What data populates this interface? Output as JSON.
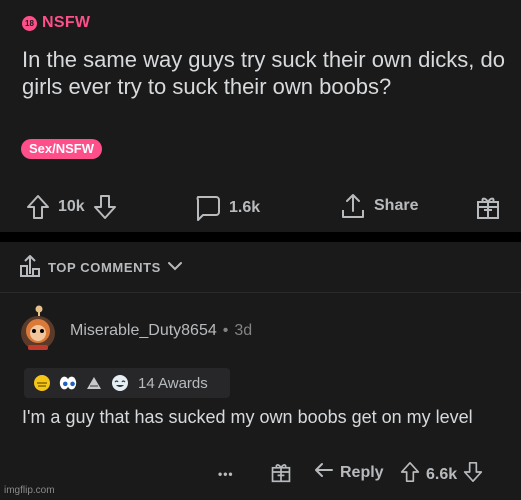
{
  "post": {
    "nsfw_icon_text": "18",
    "nsfw_label": "NSFW",
    "title": "In the same way guys try suck their own dicks, do girls ever try to suck their own boobs?",
    "flair": "Sex/NSFW",
    "upvotes": "10k",
    "comments": "1.6k",
    "share_label": "Share"
  },
  "comments_header": {
    "sort_label": "TOP COMMENTS"
  },
  "comment": {
    "author": "Miserable_Duty8654",
    "separator": "•",
    "age": "3d",
    "awards_label": "14 Awards",
    "body": "I'm a guy that has sucked my own boobs get on my level",
    "more_label": "•••",
    "reply_label": "Reply",
    "score": "6.6k"
  },
  "watermark": "imgflip.com",
  "colors": {
    "nsfw_pink": "#ff4f8b",
    "background": "#1a1a1b",
    "text": "#d7dadc",
    "muted": "#818384"
  }
}
